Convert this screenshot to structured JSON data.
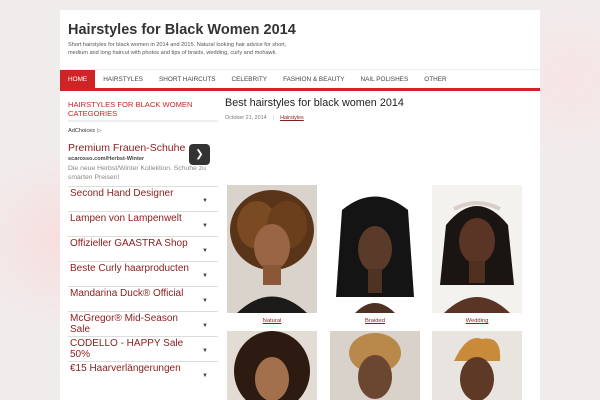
{
  "site": {
    "title": "Hairstyles for Black Women 2014",
    "tagline": "Short hairstyles for black women in 2014 and 2015. Natural looking hair advice for short, medium and long haircut with photos and tips of braids, wedding, curly and mohawk."
  },
  "nav": {
    "items": [
      {
        "label": "HOME",
        "active": true
      },
      {
        "label": "HAIRSTYLES"
      },
      {
        "label": "SHORT HAIRCUTS"
      },
      {
        "label": "CELEBRITY"
      },
      {
        "label": "FASHION & BEAUTY"
      },
      {
        "label": "NAIL POLISHES"
      },
      {
        "label": "OTHER"
      }
    ]
  },
  "sidebar": {
    "title": "HAIRSTYLES FOR BLACK WOMEN CATEGORIES",
    "adchoices": "AdChoices",
    "ad": {
      "headline": "Premium Frauen-Schuhe",
      "url": "scarosso.com/Herbst-Winter",
      "description": "Die neue Herbst/Winter Kollektion. Schuhe zu smarten Preisen!"
    },
    "ad_links": [
      "Second Hand Designer",
      "Lampen von Lampenwelt",
      "Offizieller GAASTRA Shop",
      "Beste Curly haarproducten",
      "Mandarina Duck® Official",
      "McGregor® Mid-Season Sale",
      "CODELLO - HAPPY Sale 50%",
      "€15 Haarverlängerungen"
    ]
  },
  "post": {
    "title": "Best hairstyles for black women 2014",
    "date": "October 21, 2014",
    "separator": "|",
    "category": "Hairstyles",
    "captions": [
      "Natural",
      "Braided",
      "Wedding"
    ]
  },
  "colors": {
    "accent": "#cf2426",
    "link": "#8b1c1c"
  },
  "icons": {
    "ad_next": "chevron-right-icon",
    "ad_row": "chevron-down-icon"
  }
}
